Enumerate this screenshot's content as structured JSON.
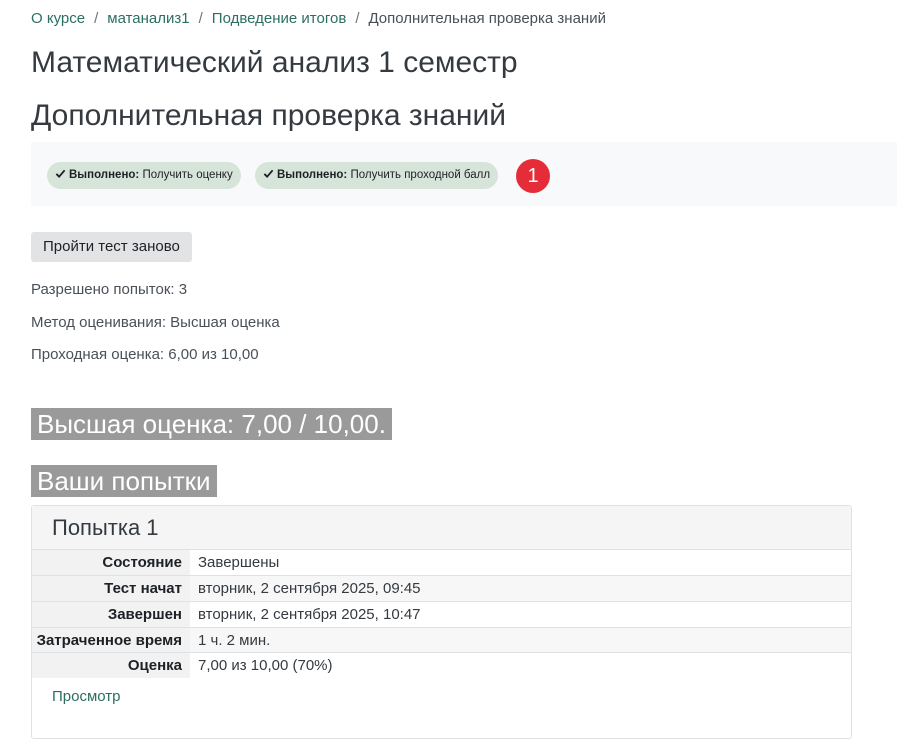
{
  "breadcrumb": {
    "items": [
      "О курсе",
      "матанализ1",
      "Подведение итогов"
    ],
    "current": "Дополнительная проверка знаний"
  },
  "course_title": "Математический анализ 1 семестр",
  "activity_title": "Дополнительная проверка знаний",
  "completion": {
    "items": [
      {
        "status": "Выполнено:",
        "text": "Получить оценку"
      },
      {
        "status": "Выполнено:",
        "text": "Получить проходной балл"
      }
    ],
    "marker": "1"
  },
  "retake_button": "Пройти тест заново",
  "info": {
    "attempts_allowed": "Разрешено попыток: 3",
    "grading_method": "Метод оценивания: Высшая оценка",
    "passing_grade": "Проходная оценка: 6,00 из 10,00"
  },
  "best_grade": "Высшая оценка: 7,00 / 10,00.",
  "attempts_heading": "Ваши попытки",
  "attempt": {
    "title": "Попытка 1",
    "rows": [
      {
        "label": "Состояние",
        "value": "Завершены"
      },
      {
        "label": "Тест начат",
        "value": "вторник, 2 сентября 2025, 09:45"
      },
      {
        "label": "Завершен",
        "value": "вторник, 2 сентября 2025, 10:47"
      },
      {
        "label": "Затраченное время",
        "value": "1 ч. 2 мин."
      },
      {
        "label": "Оценка",
        "value": "7,00 из 10,00 (70%)"
      }
    ],
    "review_link": "Просмотр"
  },
  "colors": {
    "link": "#2c6e62",
    "completion_pill": "#d7e4da",
    "marker": "#e52d3a",
    "highlight": "#9a9a9a"
  }
}
